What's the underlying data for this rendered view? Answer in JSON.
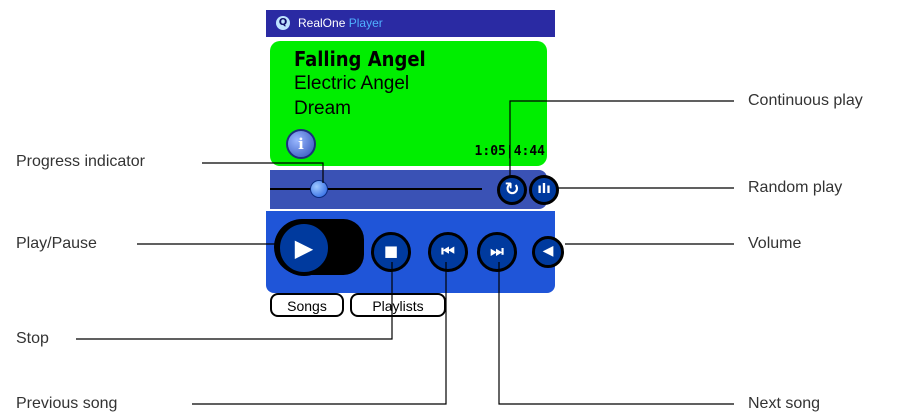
{
  "app": {
    "name_main": "RealOne",
    "name_accent": "Player",
    "logo_glyph": "Q"
  },
  "track": {
    "title": "Falling Angel",
    "artist": "Electric Angel",
    "album": "Dream",
    "elapsed": "1:05",
    "total": "4:44",
    "progress_fraction": 0.23
  },
  "icons": {
    "info": "i",
    "continuous_play": "↻",
    "random_play": "ılı",
    "play": "▶",
    "stop": "■",
    "previous": "⏮",
    "next": "⏭",
    "volume": "◀"
  },
  "tabs": {
    "songs": "Songs",
    "playlists": "Playlists"
  },
  "callouts": {
    "progress_indicator": "Progress indicator",
    "play_pause": "Play/Pause",
    "stop": "Stop",
    "previous_song": "Previous song",
    "continuous_play": "Continuous play",
    "random_play": "Random play",
    "volume": "Volume",
    "next_song": "Next song"
  },
  "colors": {
    "title_bar": "#2a2aa3",
    "info_panel": "#00ee00",
    "controls": "#1f55d8",
    "button": "#003a9e"
  }
}
